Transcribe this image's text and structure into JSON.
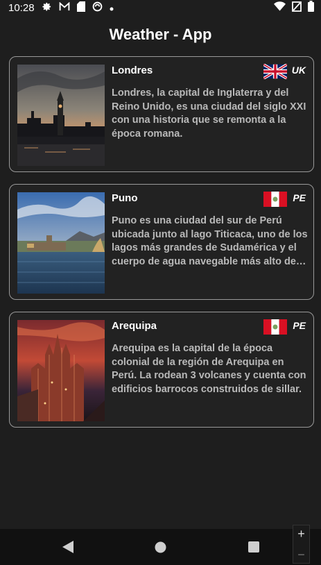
{
  "status": {
    "time": "10:28",
    "icons": [
      "gear-icon",
      "gmail-icon",
      "sd-card-icon",
      "sync-icon",
      "dot-icon"
    ],
    "right_icons": [
      "wifi-icon",
      "no-sim-icon",
      "battery-icon"
    ]
  },
  "app": {
    "title": "Weather - App"
  },
  "cards": [
    {
      "name": "Londres",
      "code": "UK",
      "flag": "uk-flag-icon",
      "description": "Londres, la capital de Inglaterra y del Reino Unido, es una ciudad del siglo XXI con una historia que se remonta a la época romana."
    },
    {
      "name": "Puno",
      "code": "PE",
      "flag": "peru-flag-icon",
      "description": "Puno es una ciudad del sur de Perú ubicada junto al lago Titicaca, uno de los lagos más grandes de Sudamérica y el cuerpo de agua navegable más alto del mundo."
    },
    {
      "name": "Arequipa",
      "code": "PE",
      "flag": "peru-flag-icon",
      "description": "Arequipa es la capital de la época colonial de la región de Arequipa en Perú. La rodean 3 volcanes y cuenta con edificios barrocos construidos de sillar."
    }
  ],
  "nav": {
    "icons": [
      "back-icon",
      "home-icon",
      "recents-icon"
    ]
  },
  "zoom": {
    "plus": "+",
    "minus": "−"
  },
  "colors": {
    "background": "#1e1e1e",
    "border": "#9a9a9a",
    "text_muted": "#b9b9b9"
  }
}
